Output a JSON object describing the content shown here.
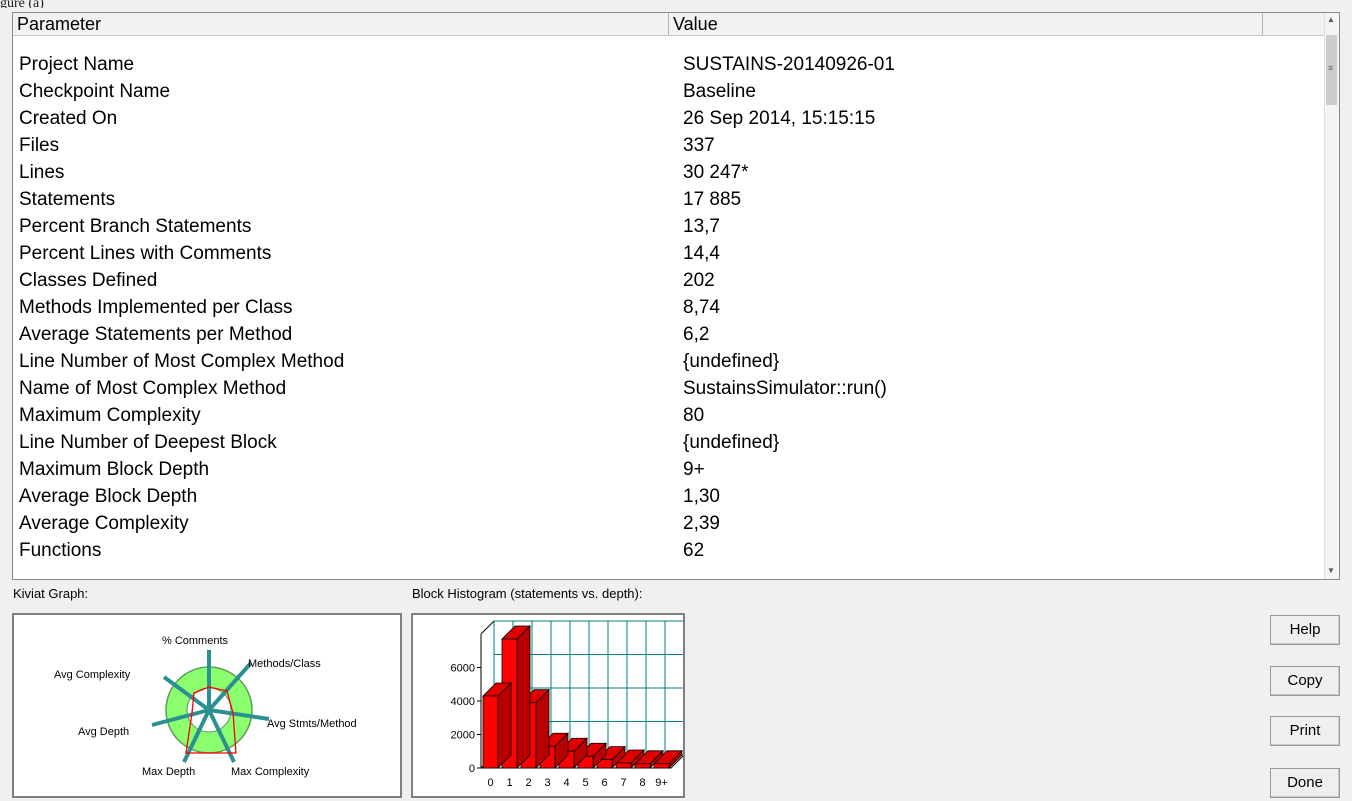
{
  "caption": "gure (a)",
  "table": {
    "col_parameter": "Parameter",
    "col_value": "Value",
    "rows": [
      {
        "param": "Project Name",
        "value": "SUSTAINS-20140926-01"
      },
      {
        "param": "Checkpoint Name",
        "value": "Baseline"
      },
      {
        "param": "Created On",
        "value": "26 Sep 2014, 15:15:15"
      },
      {
        "param": "Files",
        "value": "337"
      },
      {
        "param": "Lines",
        "value": "30 247*"
      },
      {
        "param": "Statements",
        "value": "17 885"
      },
      {
        "param": "Percent Branch Statements",
        "value": "13,7"
      },
      {
        "param": "Percent Lines with Comments",
        "value": "14,4"
      },
      {
        "param": "Classes Defined",
        "value": "202"
      },
      {
        "param": "Methods Implemented per Class",
        "value": "8,74"
      },
      {
        "param": "Average Statements per Method",
        "value": "6,2"
      },
      {
        "param": "Line Number of Most Complex Method",
        "value": "{undefined}"
      },
      {
        "param": "Name of Most Complex Method",
        "value": "SustainsSimulator::run()"
      },
      {
        "param": "Maximum Complexity",
        "value": "80"
      },
      {
        "param": "Line Number of Deepest Block",
        "value": "{undefined}"
      },
      {
        "param": "Maximum Block Depth",
        "value": "9+"
      },
      {
        "param": "Average Block Depth",
        "value": "1,30"
      },
      {
        "param": "Average Complexity",
        "value": "2,39"
      },
      {
        "param": "Functions",
        "value": "62"
      }
    ]
  },
  "kiviat": {
    "label": "Kiviat Graph:",
    "axes": [
      "% Comments",
      "Methods/Class",
      "Avg Stmts/Method",
      "Max Complexity",
      "Max Depth",
      "Avg Depth",
      "Avg Complexity"
    ]
  },
  "histogram": {
    "label": "Block Histogram (statements vs. depth):"
  },
  "chart_data": {
    "type": "bar",
    "title": "Block Histogram (statements vs. depth):",
    "categories": [
      "0",
      "1",
      "2",
      "3",
      "4",
      "5",
      "6",
      "7",
      "8",
      "9+"
    ],
    "values": [
      4300,
      7700,
      3900,
      1300,
      1000,
      700,
      500,
      300,
      250,
      250
    ],
    "yticks": [
      "0",
      "2000",
      "4000",
      "6000"
    ],
    "ylim": [
      0,
      8000
    ],
    "grid": true,
    "colors": {
      "bar": "#ff0000",
      "grid": "#008080"
    }
  },
  "buttons": {
    "help": "Help",
    "copy": "Copy",
    "print": "Print",
    "done": "Done"
  }
}
